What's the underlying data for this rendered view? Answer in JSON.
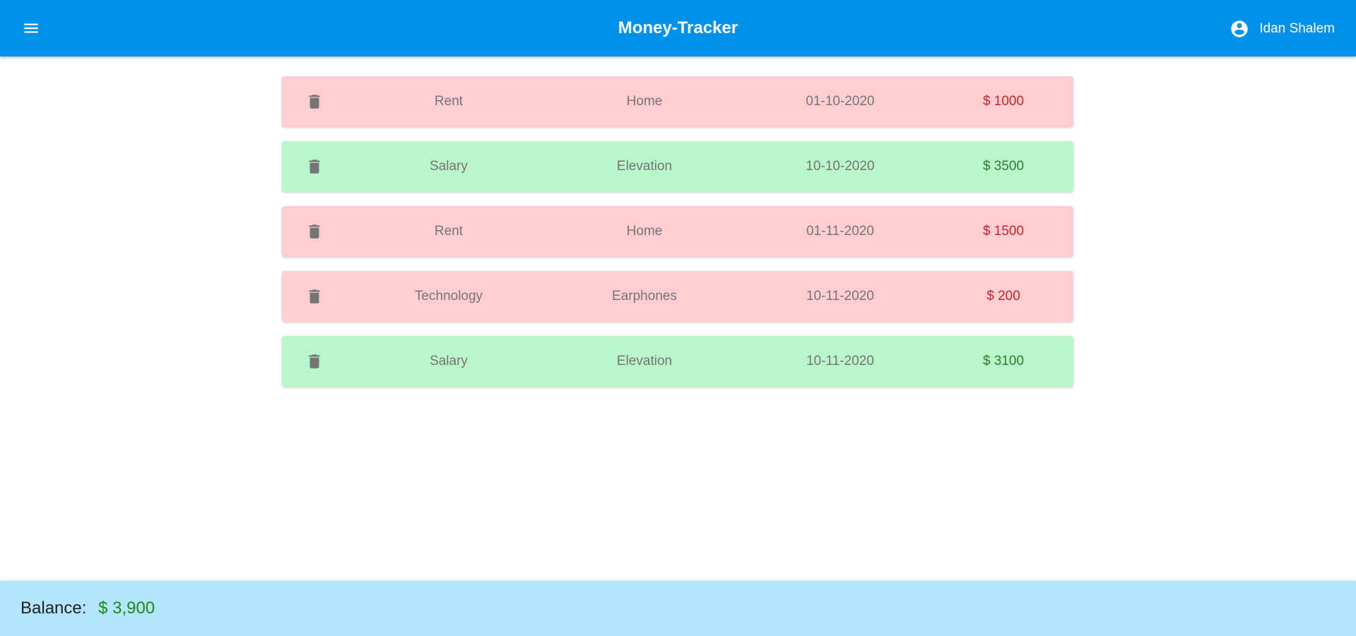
{
  "header": {
    "title": "Money-Tracker",
    "user_name": "Idan Shalem",
    "menu_icon": "menu-icon",
    "user_icon": "account-circle-icon",
    "color": "#0091ea"
  },
  "transactions": [
    {
      "category": "Rent",
      "vendor": "Home",
      "date": "01-10-2020",
      "amount": "$ 1000",
      "type": "expense"
    },
    {
      "category": "Salary",
      "vendor": "Elevation",
      "date": "10-10-2020",
      "amount": "$ 3500",
      "type": "income"
    },
    {
      "category": "Rent",
      "vendor": "Home",
      "date": "01-11-2020",
      "amount": "$ 1500",
      "type": "expense"
    },
    {
      "category": "Technology",
      "vendor": "Earphones",
      "date": "10-11-2020",
      "amount": "$ 200",
      "type": "expense"
    },
    {
      "category": "Salary",
      "vendor": "Elevation",
      "date": "10-11-2020",
      "amount": "$ 3100",
      "type": "income"
    }
  ],
  "row_colors": {
    "expense_bg": "#ffcdd2",
    "income_bg": "#b9f6ca",
    "expense_text": "#c62828",
    "income_text": "#2e7d32"
  },
  "row_icon": "delete-icon",
  "footer": {
    "balance_label": "Balance:",
    "balance_value": "$ 3,900",
    "color": "#b3e5fc"
  }
}
